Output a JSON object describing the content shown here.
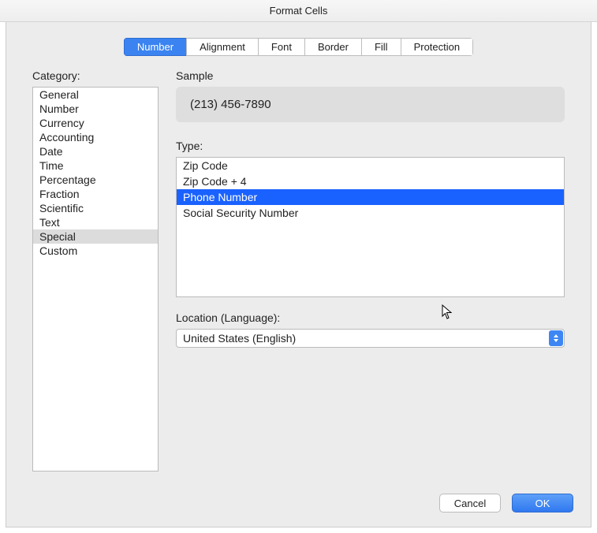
{
  "window": {
    "title": "Format Cells"
  },
  "tabs": {
    "items": [
      {
        "label": "Number",
        "selected": true
      },
      {
        "label": "Alignment",
        "selected": false
      },
      {
        "label": "Font",
        "selected": false
      },
      {
        "label": "Border",
        "selected": false
      },
      {
        "label": "Fill",
        "selected": false
      },
      {
        "label": "Protection",
        "selected": false
      }
    ]
  },
  "category": {
    "label": "Category:",
    "items": [
      {
        "label": "General",
        "selected": false
      },
      {
        "label": "Number",
        "selected": false
      },
      {
        "label": "Currency",
        "selected": false
      },
      {
        "label": "Accounting",
        "selected": false
      },
      {
        "label": "Date",
        "selected": false
      },
      {
        "label": "Time",
        "selected": false
      },
      {
        "label": "Percentage",
        "selected": false
      },
      {
        "label": "Fraction",
        "selected": false
      },
      {
        "label": "Scientific",
        "selected": false
      },
      {
        "label": "Text",
        "selected": false
      },
      {
        "label": "Special",
        "selected": true
      },
      {
        "label": "Custom",
        "selected": false
      }
    ]
  },
  "sample": {
    "label": "Sample",
    "value": "(213) 456-7890"
  },
  "type": {
    "label": "Type:",
    "items": [
      {
        "label": "Zip Code",
        "selected": false
      },
      {
        "label": "Zip Code + 4",
        "selected": false
      },
      {
        "label": "Phone Number",
        "selected": true
      },
      {
        "label": "Social Security Number",
        "selected": false
      }
    ]
  },
  "location": {
    "label": "Location (Language):",
    "value": "United States (English)"
  },
  "buttons": {
    "cancel": "Cancel",
    "ok": "OK"
  }
}
